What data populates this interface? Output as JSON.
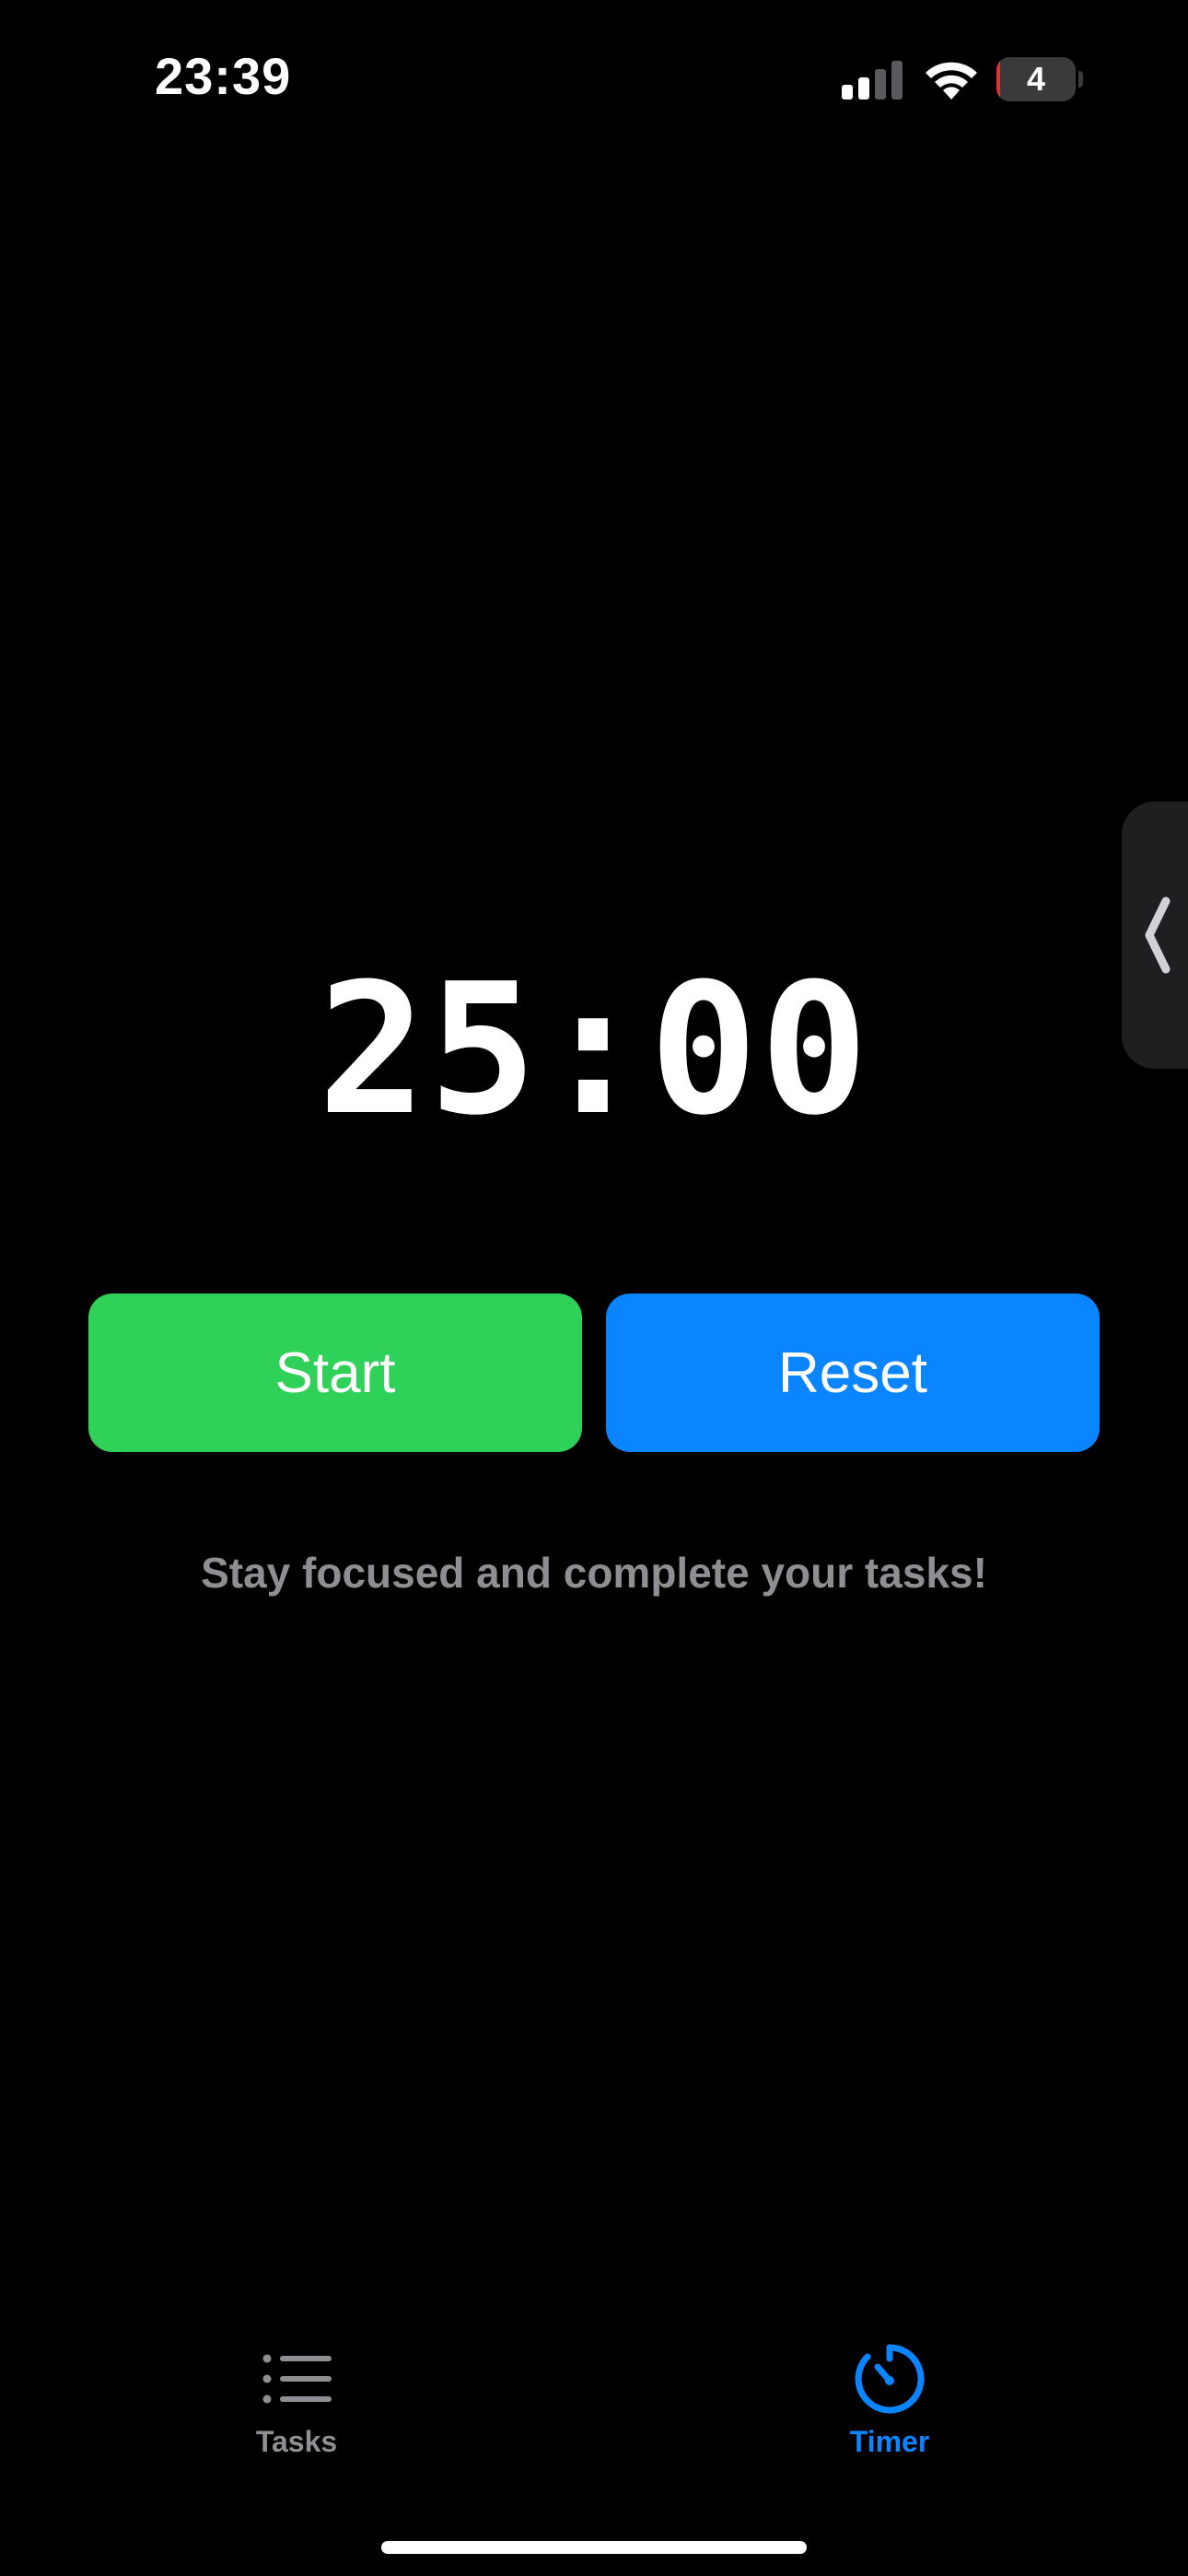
{
  "status_bar": {
    "time": "23:39",
    "battery_level": "4",
    "battery_fraction": 0.04,
    "signal_bars_active": 2,
    "signal_bars_total": 4
  },
  "timer": {
    "display": "25:00"
  },
  "controls": {
    "start_label": "Start",
    "reset_label": "Reset"
  },
  "motivation_text": "Stay focused and complete your tasks!",
  "tab_bar": {
    "items": [
      {
        "label": "Tasks",
        "icon": "list-icon",
        "selected": false
      },
      {
        "label": "Timer",
        "icon": "timer-icon",
        "selected": true
      }
    ]
  },
  "colors": {
    "background": "#000000",
    "start_button": "#30d158",
    "reset_button": "#0a84ff",
    "tab_selected": "#0a84ff",
    "tab_unselected": "#8e8e93",
    "secondary_text": "#8e8e93",
    "battery_low": "#e5322d"
  }
}
